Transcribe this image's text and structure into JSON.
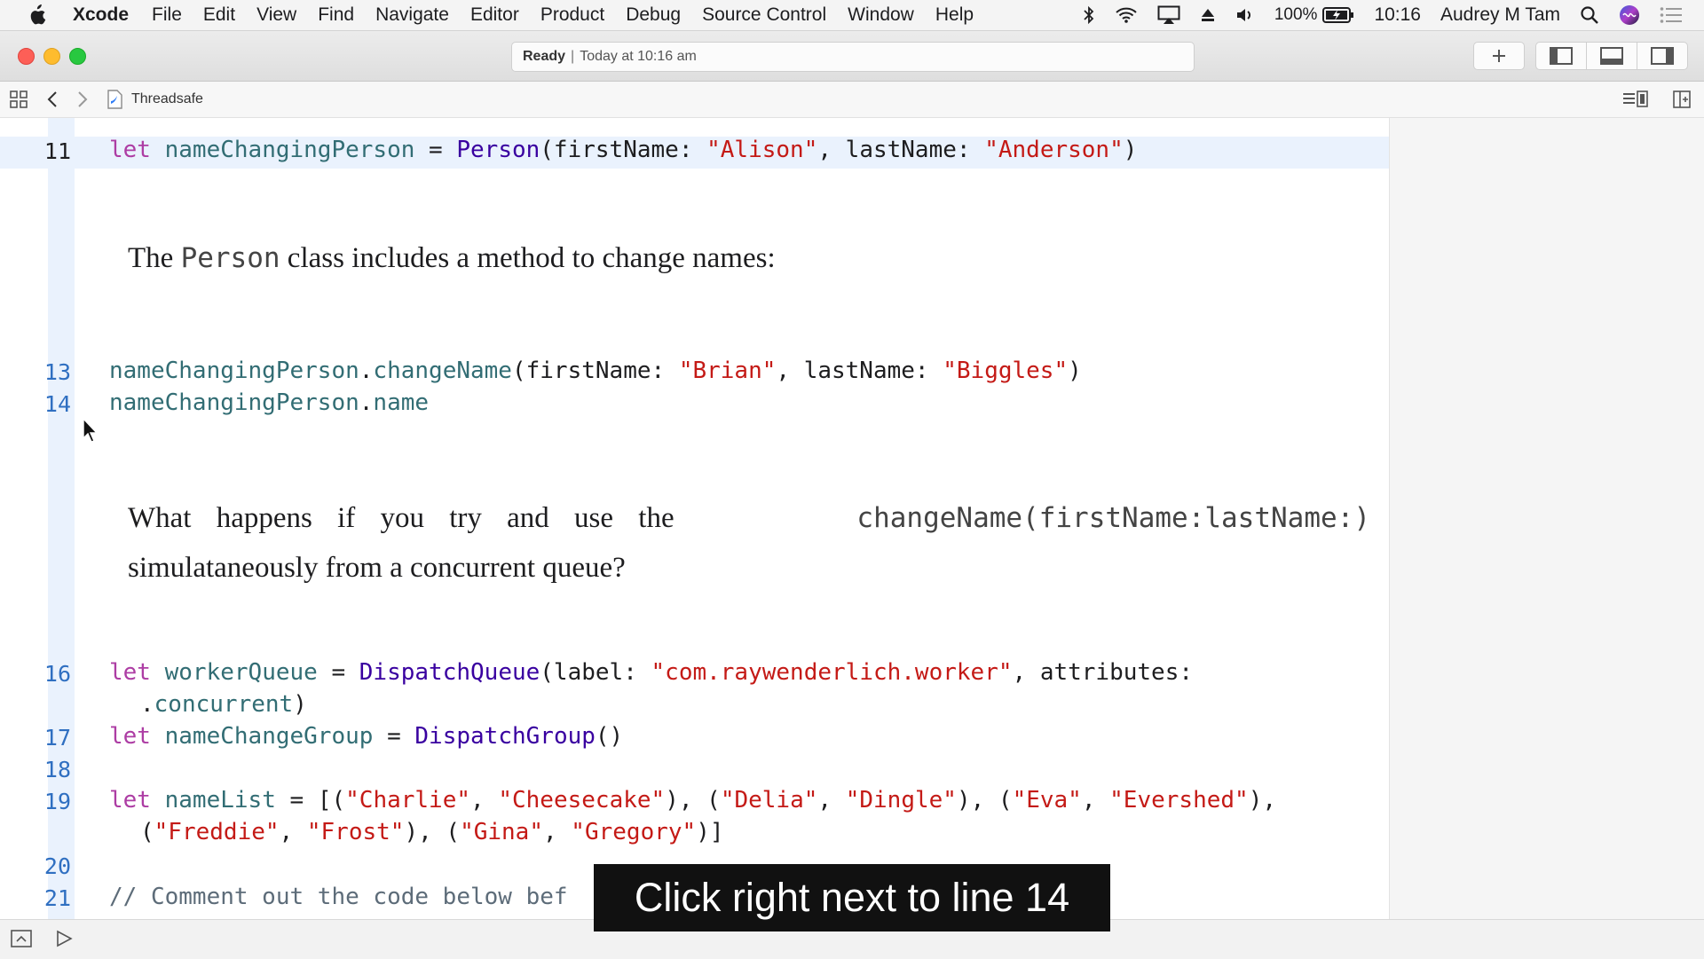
{
  "menubar": {
    "app_name": "Xcode",
    "items": [
      "File",
      "Edit",
      "View",
      "Find",
      "Navigate",
      "Editor",
      "Product",
      "Debug",
      "Source Control",
      "Window",
      "Help"
    ],
    "battery": "100%",
    "time": "10:16",
    "user": "Audrey M Tam"
  },
  "titlebar": {
    "status": "Ready",
    "separator": "|",
    "timestamp": "Today at 10:16 am"
  },
  "jumpbar": {
    "file": "Threadsafe"
  },
  "editor": {
    "line_numbers": {
      "l11": "11",
      "l13": "13",
      "l14": "14",
      "l16": "16",
      "l17": "17",
      "l18": "18",
      "l19": "19",
      "l20": "20",
      "l21": "21"
    },
    "prose1": {
      "before": "The ",
      "code": "Person",
      "after": " class includes a method to change names:"
    },
    "prose2": {
      "before": "What happens if you try and use the ",
      "code": "changeName(firstName:lastName:)",
      "after": "simulataneously from a concurrent queue?"
    },
    "code": {
      "l11": {
        "let": "let",
        "name": "nameChangingPerson",
        "eq": " = ",
        "type": "Person",
        "a": "(firstName: ",
        "s1": "\"Alison\"",
        "b": ", lastName: ",
        "s2": "\"Anderson\"",
        "c": ")"
      },
      "l13": {
        "obj": "nameChangingPerson",
        "dot": ".",
        "method": "changeName",
        "a": "(firstName: ",
        "s1": "\"Brian\"",
        "b": ", lastName: ",
        "s2": "\"Biggles\"",
        "c": ")"
      },
      "l14": {
        "obj": "nameChangingPerson",
        "dot": ".",
        "prop": "name"
      },
      "l16": {
        "let": "let",
        "name": "workerQueue",
        "eq": " = ",
        "type": "DispatchQueue",
        "a": "(label: ",
        "s1": "\"com.raywenderlich.worker\"",
        "b": ", attributes:",
        "cont_dot": ".",
        "cont": "concurrent",
        "c": ")"
      },
      "l17": {
        "let": "let",
        "name": "nameChangeGroup",
        "eq": " = ",
        "type": "DispatchGroup",
        "c": "()"
      },
      "l19": {
        "let": "let",
        "name": "nameList",
        "eq": " = [(",
        "s1": "\"Charlie\"",
        "s2": "\"Cheesecake\"",
        "s3": "\"Delia\"",
        "s4": "\"Dingle\"",
        "s5": "\"Eva\"",
        "s6": "\"Evershed\"",
        "s7": "\"Freddie\"",
        "s8": "\"Frost\"",
        "s9": "\"Gina\"",
        "s10": "\"Gregory\""
      },
      "l21": {
        "comment": "// Comment out the code below bef"
      }
    }
  },
  "caption": "Click right next to line 14"
}
